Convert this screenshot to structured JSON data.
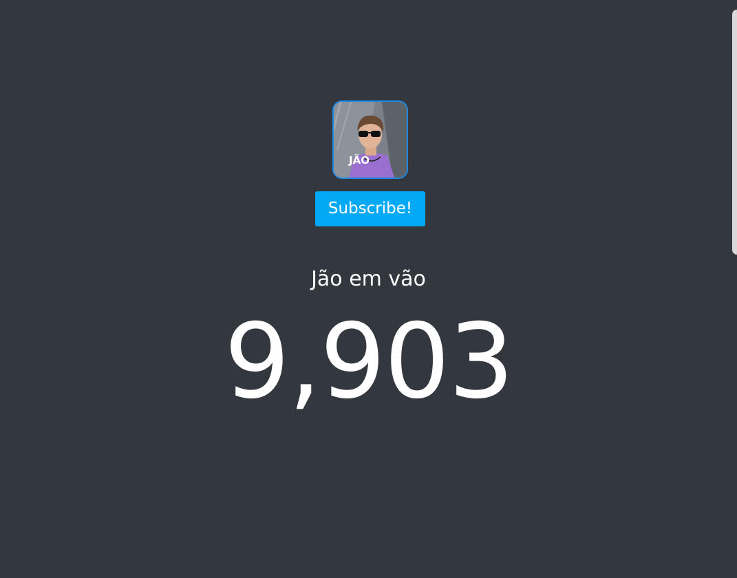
{
  "avatar": {
    "badge_text": "JÃO",
    "icon": "channel-avatar-photo"
  },
  "subscribe_button": {
    "label": "Subscribe!",
    "color": "#03a9f4"
  },
  "channel": {
    "name": "Jão em vão"
  },
  "subscriber_count": "9,903",
  "colors": {
    "background": "#33373e",
    "avatar_border": "#1e88e5",
    "text": "#ffffff"
  }
}
